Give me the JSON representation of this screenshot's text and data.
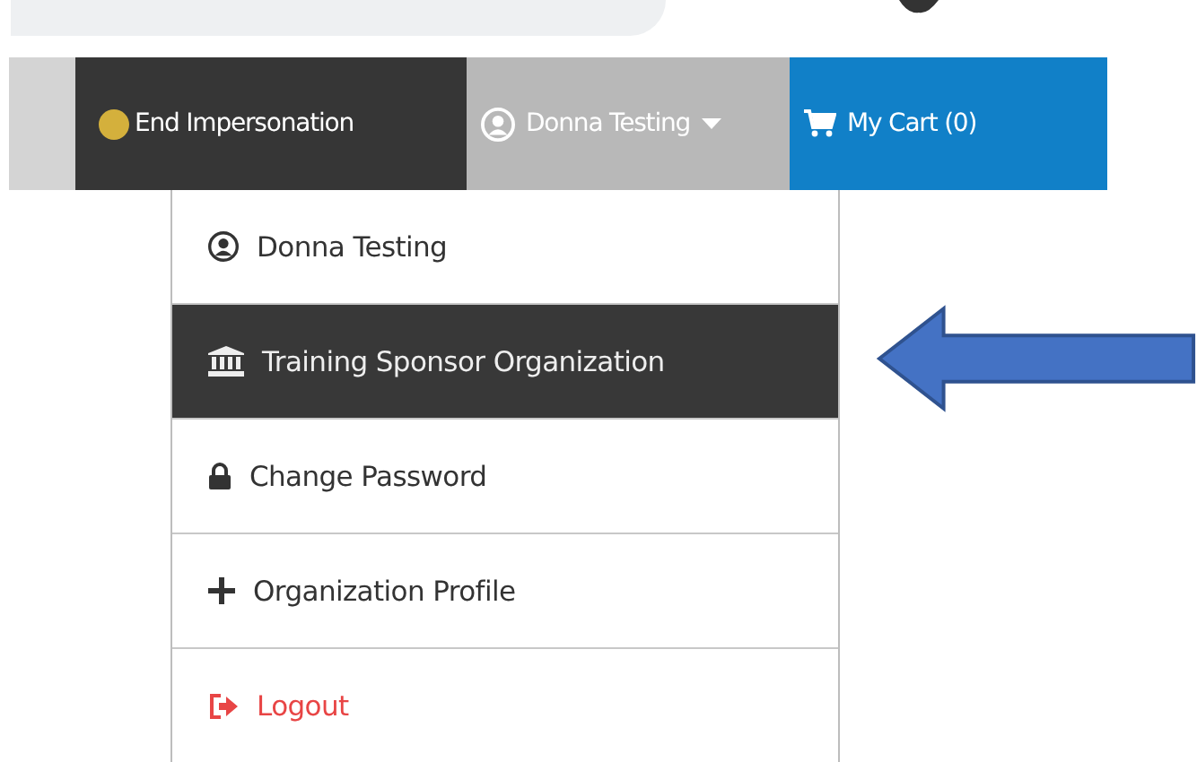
{
  "navbar": {
    "impersonation": {
      "label": "End Impersonation",
      "color": "#d4b03c"
    },
    "user": {
      "label": "Donna Testing",
      "expanded": true
    },
    "cart": {
      "label": "My Cart (0)"
    }
  },
  "menu": [
    {
      "kind": "user",
      "label": "Donna Testing",
      "selected": false
    },
    {
      "kind": "organization",
      "label": "Training Sponsor Organization",
      "selected": true
    },
    {
      "kind": "password",
      "label": "Change Password",
      "selected": false
    },
    {
      "kind": "profile",
      "label": "Organization Profile",
      "selected": false
    },
    {
      "kind": "logout",
      "label": "Logout",
      "selected": false
    }
  ]
}
